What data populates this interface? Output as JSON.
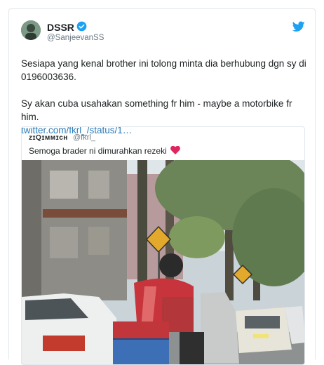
{
  "tweet": {
    "display_name": "DSSR",
    "handle": "@SanjeevanSS",
    "line1": "Sesiapa yang kenal brother ini tolong minta dia berhubung dgn sy di 0196003636.",
    "line2": "Sy akan cuba usahakan something fr him - maybe a motorbike fr him.",
    "link": "twitter.com/fkrl_/status/1…",
    "colors": {
      "link": "#2b7bb9",
      "verified": "#1da1f2",
      "bird": "#1da1f2",
      "heart": "#e0245e"
    }
  },
  "quoted_tweet": {
    "display_name": "ᴢɪQɪᴍᴍɪᴄʜ",
    "handle": "@fkrl_",
    "text": "Semoga brader ni dimurahkan rezeki",
    "emoji": "heart-icon"
  }
}
